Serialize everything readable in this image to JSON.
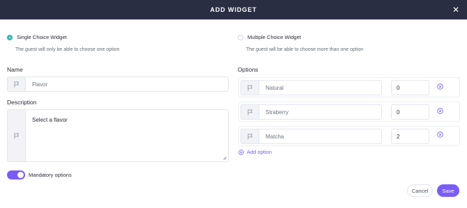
{
  "header": {
    "title": "ADD WIDGET",
    "close_icon": "close-icon"
  },
  "widget_type": {
    "single": {
      "label": "Single Choice Widget",
      "hint": "The guest will only be able to choose one option",
      "selected": true
    },
    "multiple": {
      "label": "Multiple Choice Widget",
      "hint": "The guest will be able to choose more than one option",
      "selected": false
    }
  },
  "name": {
    "label": "Name",
    "placeholder": "Flavor"
  },
  "description": {
    "label": "Description",
    "value": "Select a flavor"
  },
  "options": {
    "label": "Options",
    "items": [
      {
        "name": "Natural",
        "quantity": "0"
      },
      {
        "name": "Straberry",
        "quantity": "0"
      },
      {
        "name": "Matcha",
        "quantity": "2"
      }
    ],
    "add_label": "Add option"
  },
  "mandatory": {
    "label": "Mandatory options",
    "enabled": true
  },
  "footer": {
    "cancel_label": "Cancel",
    "save_label": "Save"
  },
  "colors": {
    "header": "#2a2e43",
    "accent": "#7a5cf5",
    "radio_checked": "#39b5b0"
  }
}
